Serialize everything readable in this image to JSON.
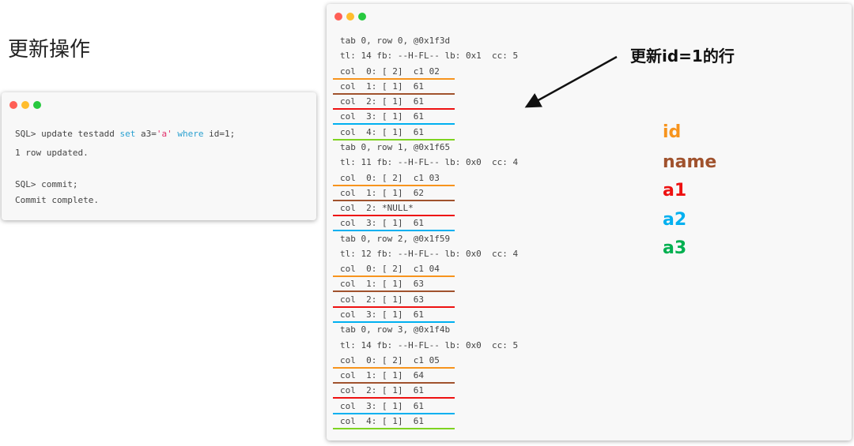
{
  "page_title": "更新操作",
  "sql_window": {
    "lines": [
      {
        "parts": [
          {
            "t": "SQL> update testadd ",
            "c": ""
          },
          {
            "t": "set",
            "c": "kw"
          },
          {
            "t": " a3=",
            "c": ""
          },
          {
            "t": "'a'",
            "c": "str"
          },
          {
            "t": " ",
            "c": ""
          },
          {
            "t": "where",
            "c": "kw"
          },
          {
            "t": " id=1;",
            "c": ""
          }
        ]
      },
      {
        "parts": [
          {
            "t": "1 row updated.",
            "c": ""
          }
        ]
      },
      {
        "parts": [
          {
            "t": "SQL> commit;",
            "c": ""
          }
        ]
      },
      {
        "parts": [
          {
            "t": "Commit complete.",
            "c": ""
          }
        ]
      }
    ]
  },
  "dump_window": {
    "lines": [
      {
        "text": "tab 0, row 0, @0x1f3d",
        "u": null
      },
      {
        "text": "tl: 14 fb: --H-FL-- lb: 0x1  cc: 5",
        "u": null
      },
      {
        "text": "col  0: [ 2]  c1 02",
        "u": "#f7941d"
      },
      {
        "text": "col  1: [ 1]  61",
        "u": "#a0522d"
      },
      {
        "text": "col  2: [ 1]  61",
        "u": "#ee1111"
      },
      {
        "text": "col  3: [ 1]  61",
        "u": "#00b0f0"
      },
      {
        "text": "col  4: [ 1]  61",
        "u": "#7ed321"
      },
      {
        "text": "tab 0, row 1, @0x1f65",
        "u": null
      },
      {
        "text": "tl: 11 fb: --H-FL-- lb: 0x0  cc: 4",
        "u": null
      },
      {
        "text": "col  0: [ 2]  c1 03",
        "u": "#f7941d"
      },
      {
        "text": "col  1: [ 1]  62",
        "u": "#a0522d"
      },
      {
        "text": "col  2: *NULL*",
        "u": "#ee1111"
      },
      {
        "text": "col  3: [ 1]  61",
        "u": "#00b0f0"
      },
      {
        "text": "tab 0, row 2, @0x1f59",
        "u": null
      },
      {
        "text": "tl: 12 fb: --H-FL-- lb: 0x0  cc: 4",
        "u": null
      },
      {
        "text": "col  0: [ 2]  c1 04",
        "u": "#f7941d"
      },
      {
        "text": "col  1: [ 1]  63",
        "u": "#a0522d"
      },
      {
        "text": "col  2: [ 1]  63",
        "u": "#ee1111"
      },
      {
        "text": "col  3: [ 1]  61",
        "u": "#00b0f0"
      },
      {
        "text": "tab 0, row 3, @0x1f4b",
        "u": null
      },
      {
        "text": "tl: 14 fb: --H-FL-- lb: 0x0  cc: 5",
        "u": null
      },
      {
        "text": "col  0: [ 2]  c1 05",
        "u": "#f7941d"
      },
      {
        "text": "col  1: [ 1]  64",
        "u": "#a0522d"
      },
      {
        "text": "col  2: [ 1]  61",
        "u": "#ee1111"
      },
      {
        "text": "col  3: [ 1]  61",
        "u": "#00b0f0"
      },
      {
        "text": "col  4: [ 1]  61",
        "u": "#7ed321"
      }
    ]
  },
  "annotation": "更新id=1的行",
  "legend": [
    {
      "label": "id",
      "color": "#f7941d"
    },
    {
      "label": "name",
      "color": "#a0522d"
    },
    {
      "label": "a1",
      "color": "#ee1111"
    },
    {
      "label": "a2",
      "color": "#00b0f0"
    },
    {
      "label": "a3",
      "color": "#00b050"
    }
  ],
  "window_dots": [
    "#ff5f56",
    "#ffbd2e",
    "#27c93f"
  ]
}
